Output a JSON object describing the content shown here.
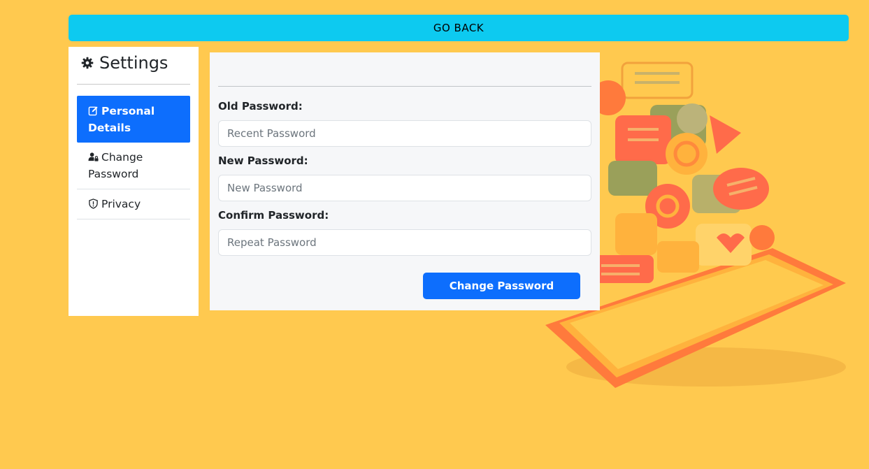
{
  "header": {
    "go_back_label": "GO BACK"
  },
  "sidebar": {
    "title": "Settings",
    "title_icon": "gear-icon",
    "items": [
      {
        "label": "Personal Details",
        "icon": "edit-icon",
        "active": true
      },
      {
        "label": "Change Password",
        "icon": "user-lock-icon",
        "active": false
      },
      {
        "label": "Privacy",
        "icon": "shield-exclamation-icon",
        "active": false
      }
    ]
  },
  "form": {
    "old_password": {
      "label": "Old Password:",
      "placeholder": "Recent Password",
      "value": ""
    },
    "new_password": {
      "label": "New Password:",
      "placeholder": "New Password",
      "value": ""
    },
    "confirm_password": {
      "label": "Confirm Password:",
      "placeholder": "Repeat Password",
      "value": ""
    },
    "submit_label": "Change Password"
  },
  "colors": {
    "background": "#ffc94f",
    "go_back": "#0dcaf0",
    "primary": "#0d6efd",
    "panel": "#f6f7f9"
  }
}
